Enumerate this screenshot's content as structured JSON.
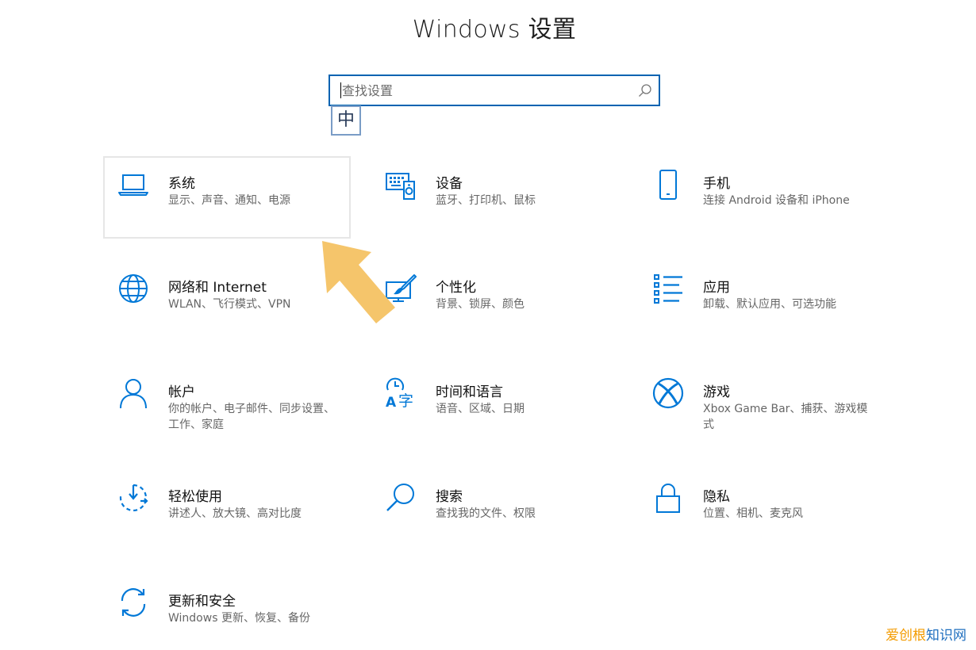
{
  "window": {
    "title": "Windows 设置"
  },
  "search": {
    "placeholder": "查找设置",
    "value": "",
    "ime_indicator": "中"
  },
  "accent_color": "#0078d7",
  "tiles": [
    {
      "name": "系统",
      "desc": "显示、声音、通知、电源",
      "icon": "laptop-icon",
      "selected": true
    },
    {
      "name": "设备",
      "desc": "蓝牙、打印机、鼠标",
      "icon": "devices-icon",
      "selected": false
    },
    {
      "name": "手机",
      "desc": "连接 Android 设备和 iPhone",
      "icon": "phone-icon",
      "selected": false
    },
    {
      "name": "网络和 Internet",
      "desc": "WLAN、飞行模式、VPN",
      "icon": "globe-icon",
      "selected": false
    },
    {
      "name": "个性化",
      "desc": "背景、锁屏、颜色",
      "icon": "paintbrush-icon",
      "selected": false
    },
    {
      "name": "应用",
      "desc": "卸载、默认应用、可选功能",
      "icon": "apps-list-icon",
      "selected": false
    },
    {
      "name": "帐户",
      "desc": "你的帐户、电子邮件、同步设置、工作、家庭",
      "icon": "person-icon",
      "selected": false
    },
    {
      "name": "时间和语言",
      "desc": "语音、区域、日期",
      "icon": "time-language-icon",
      "selected": false
    },
    {
      "name": "游戏",
      "desc": "Xbox Game Bar、捕获、游戏模式",
      "icon": "xbox-icon",
      "selected": false
    },
    {
      "name": "轻松使用",
      "desc": "讲述人、放大镜、高对比度",
      "icon": "ease-of-access-icon",
      "selected": false
    },
    {
      "name": "搜索",
      "desc": "查找我的文件、权限",
      "icon": "search-icon",
      "selected": false
    },
    {
      "name": "隐私",
      "desc": "位置、相机、麦克风",
      "icon": "lock-icon",
      "selected": false
    },
    {
      "name": "更新和安全",
      "desc": "Windows 更新、恢复、备份",
      "icon": "refresh-icon",
      "selected": false
    }
  ],
  "watermark": {
    "part1": "爱创根",
    "part2": "知识网"
  }
}
